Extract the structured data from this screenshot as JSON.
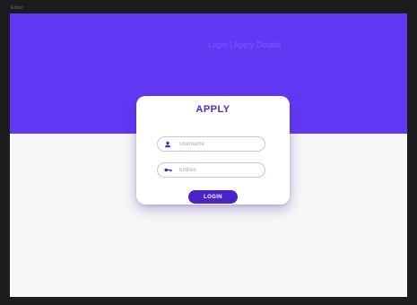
{
  "window": {
    "caption": "Editor"
  },
  "hero": {
    "faint_text": "Login | Apply Details",
    "color": "#6338f5"
  },
  "login_card": {
    "title": "APPLY",
    "username": {
      "placeholder": "Username",
      "value": "",
      "icon": "user-icon"
    },
    "password": {
      "placeholder": "Entries",
      "value": "",
      "icon": "key-icon"
    },
    "login_label": "LOGIN",
    "accent_color": "#4b24c9"
  }
}
